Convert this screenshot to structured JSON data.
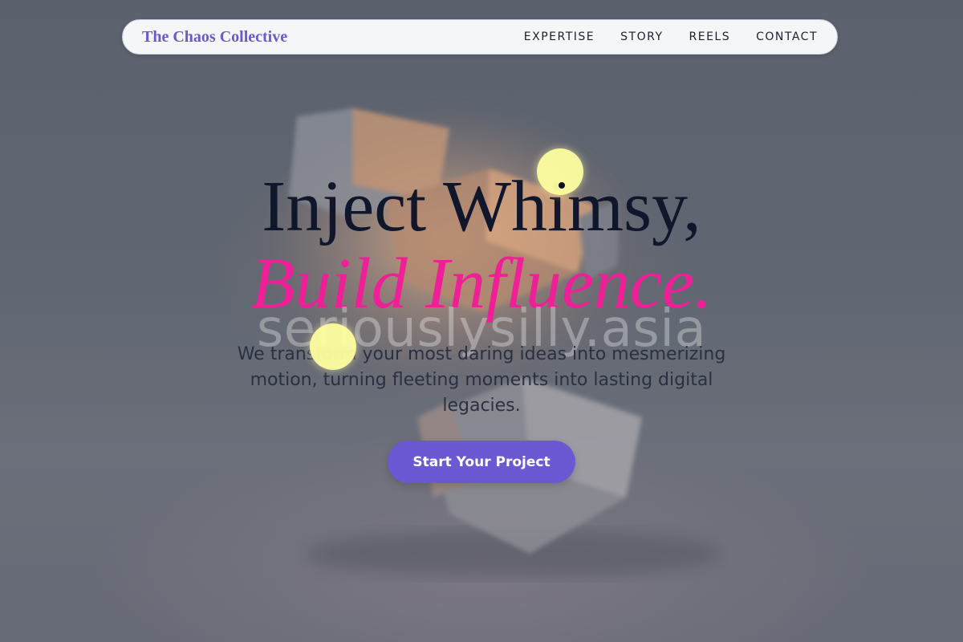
{
  "nav": {
    "logo": "The Chaos Collective",
    "items": [
      {
        "label": "EXPERTISE"
      },
      {
        "label": "STORY"
      },
      {
        "label": "REELS"
      },
      {
        "label": "CONTACT"
      }
    ]
  },
  "hero": {
    "headline_line1": "Inject Whimsy,",
    "headline_line2": "Build Influence.",
    "watermark": "seriouslysilly.asia",
    "subtitle": "We transform your most daring ideas into mesmerizing motion, turning fleeting moments into lasting digital legacies.",
    "cta_label": "Start Your Project"
  },
  "colors": {
    "accent": "#6b58d3",
    "logo": "#6a5acd",
    "headline": "#10162b",
    "highlight": "#ee1f97",
    "dot": "#ffffa0"
  }
}
